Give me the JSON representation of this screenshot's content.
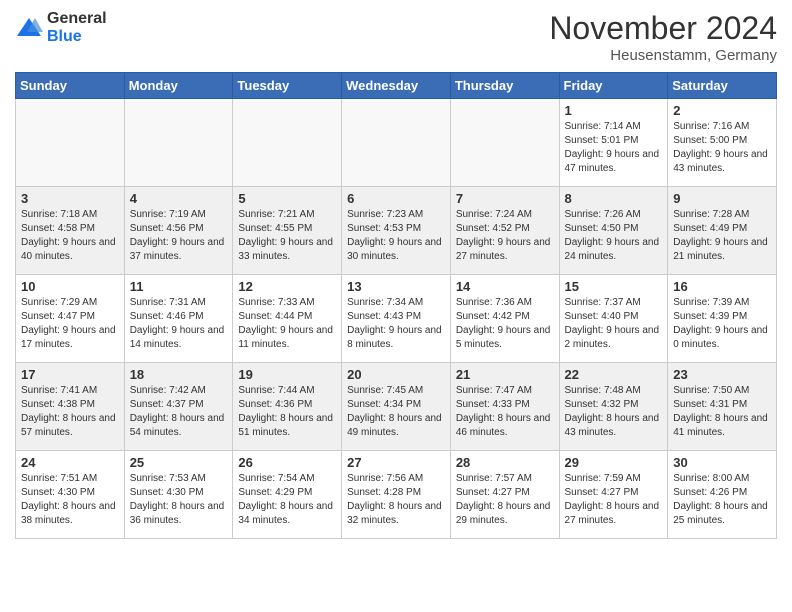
{
  "logo": {
    "general": "General",
    "blue": "Blue"
  },
  "title": "November 2024",
  "location": "Heusenstamm, Germany",
  "headers": [
    "Sunday",
    "Monday",
    "Tuesday",
    "Wednesday",
    "Thursday",
    "Friday",
    "Saturday"
  ],
  "weeks": [
    [
      {
        "day": "",
        "info": ""
      },
      {
        "day": "",
        "info": ""
      },
      {
        "day": "",
        "info": ""
      },
      {
        "day": "",
        "info": ""
      },
      {
        "day": "",
        "info": ""
      },
      {
        "day": "1",
        "info": "Sunrise: 7:14 AM\nSunset: 5:01 PM\nDaylight: 9 hours\nand 47 minutes."
      },
      {
        "day": "2",
        "info": "Sunrise: 7:16 AM\nSunset: 5:00 PM\nDaylight: 9 hours\nand 43 minutes."
      }
    ],
    [
      {
        "day": "3",
        "info": "Sunrise: 7:18 AM\nSunset: 4:58 PM\nDaylight: 9 hours\nand 40 minutes."
      },
      {
        "day": "4",
        "info": "Sunrise: 7:19 AM\nSunset: 4:56 PM\nDaylight: 9 hours\nand 37 minutes."
      },
      {
        "day": "5",
        "info": "Sunrise: 7:21 AM\nSunset: 4:55 PM\nDaylight: 9 hours\nand 33 minutes."
      },
      {
        "day": "6",
        "info": "Sunrise: 7:23 AM\nSunset: 4:53 PM\nDaylight: 9 hours\nand 30 minutes."
      },
      {
        "day": "7",
        "info": "Sunrise: 7:24 AM\nSunset: 4:52 PM\nDaylight: 9 hours\nand 27 minutes."
      },
      {
        "day": "8",
        "info": "Sunrise: 7:26 AM\nSunset: 4:50 PM\nDaylight: 9 hours\nand 24 minutes."
      },
      {
        "day": "9",
        "info": "Sunrise: 7:28 AM\nSunset: 4:49 PM\nDaylight: 9 hours\nand 21 minutes."
      }
    ],
    [
      {
        "day": "10",
        "info": "Sunrise: 7:29 AM\nSunset: 4:47 PM\nDaylight: 9 hours\nand 17 minutes."
      },
      {
        "day": "11",
        "info": "Sunrise: 7:31 AM\nSunset: 4:46 PM\nDaylight: 9 hours\nand 14 minutes."
      },
      {
        "day": "12",
        "info": "Sunrise: 7:33 AM\nSunset: 4:44 PM\nDaylight: 9 hours\nand 11 minutes."
      },
      {
        "day": "13",
        "info": "Sunrise: 7:34 AM\nSunset: 4:43 PM\nDaylight: 9 hours\nand 8 minutes."
      },
      {
        "day": "14",
        "info": "Sunrise: 7:36 AM\nSunset: 4:42 PM\nDaylight: 9 hours\nand 5 minutes."
      },
      {
        "day": "15",
        "info": "Sunrise: 7:37 AM\nSunset: 4:40 PM\nDaylight: 9 hours\nand 2 minutes."
      },
      {
        "day": "16",
        "info": "Sunrise: 7:39 AM\nSunset: 4:39 PM\nDaylight: 9 hours\nand 0 minutes."
      }
    ],
    [
      {
        "day": "17",
        "info": "Sunrise: 7:41 AM\nSunset: 4:38 PM\nDaylight: 8 hours\nand 57 minutes."
      },
      {
        "day": "18",
        "info": "Sunrise: 7:42 AM\nSunset: 4:37 PM\nDaylight: 8 hours\nand 54 minutes."
      },
      {
        "day": "19",
        "info": "Sunrise: 7:44 AM\nSunset: 4:36 PM\nDaylight: 8 hours\nand 51 minutes."
      },
      {
        "day": "20",
        "info": "Sunrise: 7:45 AM\nSunset: 4:34 PM\nDaylight: 8 hours\nand 49 minutes."
      },
      {
        "day": "21",
        "info": "Sunrise: 7:47 AM\nSunset: 4:33 PM\nDaylight: 8 hours\nand 46 minutes."
      },
      {
        "day": "22",
        "info": "Sunrise: 7:48 AM\nSunset: 4:32 PM\nDaylight: 8 hours\nand 43 minutes."
      },
      {
        "day": "23",
        "info": "Sunrise: 7:50 AM\nSunset: 4:31 PM\nDaylight: 8 hours\nand 41 minutes."
      }
    ],
    [
      {
        "day": "24",
        "info": "Sunrise: 7:51 AM\nSunset: 4:30 PM\nDaylight: 8 hours\nand 38 minutes."
      },
      {
        "day": "25",
        "info": "Sunrise: 7:53 AM\nSunset: 4:30 PM\nDaylight: 8 hours\nand 36 minutes."
      },
      {
        "day": "26",
        "info": "Sunrise: 7:54 AM\nSunset: 4:29 PM\nDaylight: 8 hours\nand 34 minutes."
      },
      {
        "day": "27",
        "info": "Sunrise: 7:56 AM\nSunset: 4:28 PM\nDaylight: 8 hours\nand 32 minutes."
      },
      {
        "day": "28",
        "info": "Sunrise: 7:57 AM\nSunset: 4:27 PM\nDaylight: 8 hours\nand 29 minutes."
      },
      {
        "day": "29",
        "info": "Sunrise: 7:59 AM\nSunset: 4:27 PM\nDaylight: 8 hours\nand 27 minutes."
      },
      {
        "day": "30",
        "info": "Sunrise: 8:00 AM\nSunset: 4:26 PM\nDaylight: 8 hours\nand 25 minutes."
      }
    ]
  ]
}
